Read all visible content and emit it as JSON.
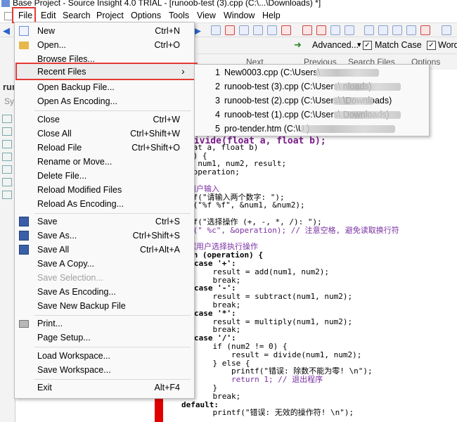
{
  "window": {
    "title": "Base Project - Source Insight 4.0 TRIAL - [runoob-test (3).cpp (C:\\...\\Downloads) *]"
  },
  "menubar": [
    "File",
    "Edit",
    "Search",
    "Project",
    "Options",
    "Tools",
    "View",
    "Window",
    "Help"
  ],
  "toolbar": {
    "advanced_label": "Advanced...",
    "match_case_label": "Match Case",
    "word_label": "Word",
    "next_label": "Next",
    "previous_label": "Previous",
    "search_files_label": "Search Files",
    "options_label": "Options"
  },
  "left_panel_text": "run",
  "left_panel_input": "Sy",
  "file_menu": {
    "items": [
      {
        "label": "New",
        "shortcut": "Ctrl+N"
      },
      {
        "label": "Open...",
        "shortcut": "Ctrl+O"
      },
      {
        "label": "Browse Files...",
        "shortcut": ""
      },
      {
        "label": "Recent Files",
        "shortcut": "›"
      },
      {
        "label": "Open Backup File...",
        "shortcut": ""
      },
      {
        "label": "Open As Encoding...",
        "shortcut": ""
      },
      {
        "label": "Close",
        "shortcut": "Ctrl+W"
      },
      {
        "label": "Close All",
        "shortcut": "Ctrl+Shift+W"
      },
      {
        "label": "Reload File",
        "shortcut": "Ctrl+Shift+O"
      },
      {
        "label": "Rename or Move...",
        "shortcut": ""
      },
      {
        "label": "Delete File...",
        "shortcut": ""
      },
      {
        "label": "Reload Modified Files",
        "shortcut": ""
      },
      {
        "label": "Reload As Encoding...",
        "shortcut": ""
      },
      {
        "label": "Save",
        "shortcut": "Ctrl+S"
      },
      {
        "label": "Save As...",
        "shortcut": "Ctrl+Shift+S"
      },
      {
        "label": "Save All",
        "shortcut": "Ctrl+Alt+A"
      },
      {
        "label": "Save A Copy...",
        "shortcut": ""
      },
      {
        "label": "Save Selection...",
        "shortcut": ""
      },
      {
        "label": "Save As Encoding...",
        "shortcut": ""
      },
      {
        "label": "Save New Backup File",
        "shortcut": ""
      },
      {
        "label": "Print...",
        "shortcut": ""
      },
      {
        "label": "Page Setup...",
        "shortcut": ""
      },
      {
        "label": "Load Workspace...",
        "shortcut": ""
      },
      {
        "label": "Save Workspace...",
        "shortcut": ""
      },
      {
        "label": "Exit",
        "shortcut": "Alt+F4"
      }
    ]
  },
  "recent_files": [
    {
      "num": "1",
      "path": "New0003.cpp (C:\\Users\\"
    },
    {
      "num": "2",
      "path": "runoob-test (3).cpp (C:\\Users\\                              nloads)"
    },
    {
      "num": "3",
      "path": "runoob-test (2).cpp (C:\\Users\\                     \\Downloads)"
    },
    {
      "num": "4",
      "path": "runoob-test (1).cpp (C:\\Users\\                              Downloads)"
    },
    {
      "num": "5",
      "path": "pro-tender.htm (C:\\U                                                 )"
    }
  ],
  "code": {
    "sig1": "divide(float a, float b);",
    "lines": [
      "oat a, float b)",
      "() {",
      "t num1, num2, result;",
      " operation;",
      "",
      "用户输入",
      "tf(\"请输入两个数字: \");",
      "f(\"%f %f\", &num1, &num2);",
      "",
      "tf(\"选择操作 (+, -, *, /): \");",
      "f(\" %c\", &operation); // 注意空格, 避免读取换行符",
      "",
      "据用户选择执行操作",
      "ch (operation) {",
      "case '+':",
      "    result = add(num1, num2);",
      "    break;",
      "case '-':",
      "    result = subtract(num1, num2);",
      "    break;",
      "case '*':",
      "    result = multiply(num1, num2);",
      "    break;",
      "case '/':",
      "    if (num2 != 0) {",
      "        result = divide(num1, num2);",
      "    } else {",
      "        printf(\"错误: 除数不能为零! \\n\");",
      "        return 1; // 退出程序",
      "    }",
      "    break;",
      "default:",
      "    printf(\"错误: 无效的操作符! \\n\");"
    ]
  },
  "colors": {
    "highlight": "#e53935",
    "red_bar": "#e00000"
  }
}
